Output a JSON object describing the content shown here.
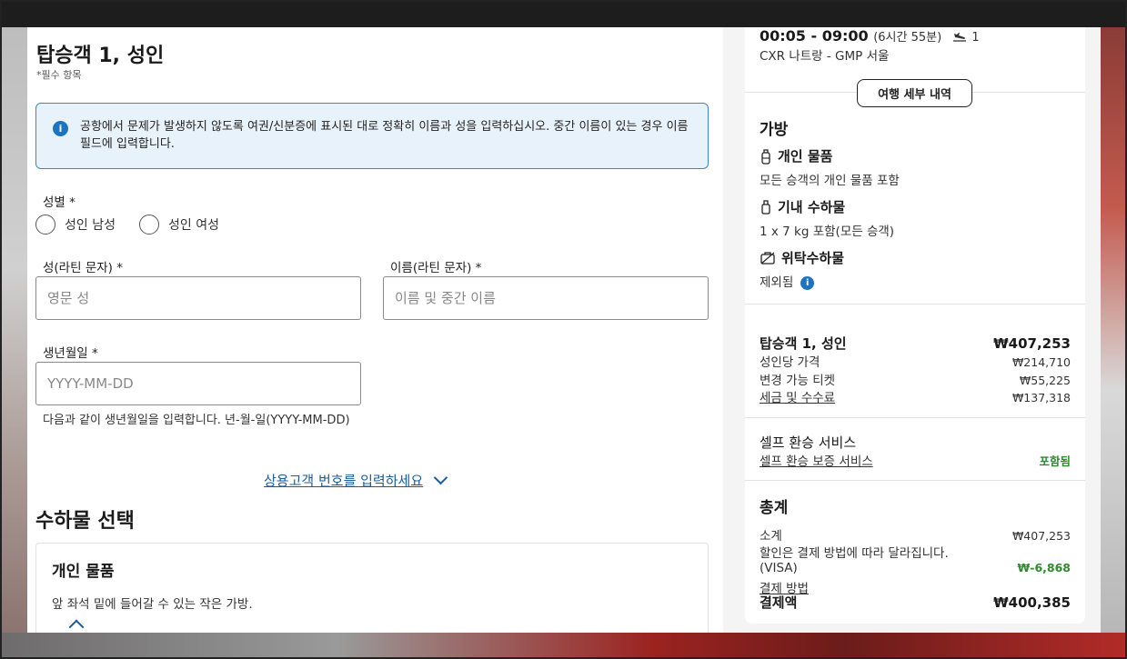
{
  "passenger_form": {
    "title": "탑승객 1, 성인",
    "required_note": "*필수 항목",
    "info_message": "공항에서 문제가 발생하지 않도록 여권/신분증에 표시된 대로 정확히 이름과 성을 입력하십시오. 중간 이름이 있는 경우 이름 필드에 입력합니다.",
    "gender_label": "성별 *",
    "gender_options": [
      "성인 남성",
      "성인 여성"
    ],
    "last_name_label": "성(라틴 문자) *",
    "last_name_placeholder": "영문 성",
    "first_name_label": "이름(라틴 문자) *",
    "first_name_placeholder": "이름 및 중간 이름",
    "dob_label": "생년월일 *",
    "dob_placeholder": "YYYY-MM-DD",
    "dob_hint": "다음과 같이 생년월일을 입력합니다. 년-월-일(YYYY-MM-DD)",
    "frequent_flyer_link": "상용고객 번호를 입력하세요"
  },
  "baggage_section": {
    "title": "수하물 선택",
    "card_title": "개인 물품",
    "card_desc": "앞 좌석 밑에 들어갈 수 있는 작은 가방."
  },
  "summary": {
    "time": "00:05 - 09:00",
    "duration": "(6시간 55분)",
    "stops": "1",
    "route": "CXR 나트랑 - GMP 서울",
    "trip_details_button": "여행 세부 내역",
    "bags_title": "가방",
    "personal_item_title": "개인 물품",
    "personal_item_desc": "모든 승객의 개인 물품 포함",
    "carry_on_title": "기내 수하물",
    "carry_on_desc": "1 x 7 kg 포함(모든 승객)",
    "checked_title": "위탁수하물",
    "checked_desc": "제외됨",
    "passenger_title": "탑승객 1, 성인",
    "passenger_total": "₩407,253",
    "adult_price_label": "성인당 가격",
    "adult_price": "₩214,710",
    "flex_ticket_label": "변경 가능 티켓",
    "flex_ticket_price": "₩55,225",
    "taxes_label": "세금 및 수수료",
    "taxes_price": "₩137,318",
    "self_transfer_title": "셀프 환승 서비스",
    "self_transfer_link": "셀프 환승 보증 서비스",
    "self_transfer_status": "포함됨",
    "total_title": "총계",
    "subtotal_label": "소계",
    "subtotal": "₩407,253",
    "discount_note": "할인은 결제 방법에 따라 달라집니다.",
    "visa_label": "(VISA)",
    "visa_discount": "₩-6,868",
    "payment_method_link": "결제 방법",
    "final_label": "결제액",
    "final_amount": "₩400,385"
  },
  "colors": {
    "accent": "#1e73be",
    "link": "#1a5c9a",
    "info_bg": "#e8f2fb",
    "success": "#2e8b2e"
  }
}
